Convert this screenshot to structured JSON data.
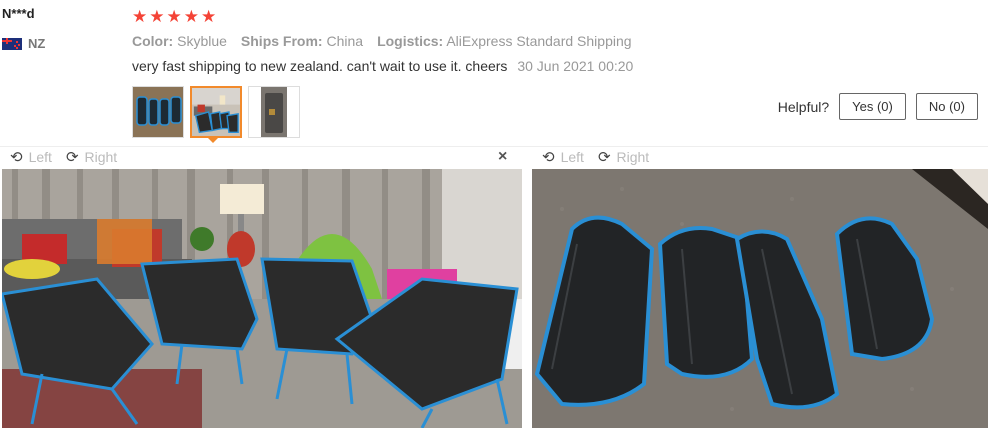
{
  "review": {
    "user": "N***d",
    "country": "NZ",
    "rating": 5,
    "star_glyph": "★",
    "color_label": "Color:",
    "color_value": "Skyblue",
    "ships_label": "Ships From:",
    "ships_value": "China",
    "logistics_label": "Logistics:",
    "logistics_value": "AliExpress Standard Shipping",
    "text": "very fast shipping to new zealand. can't wait to use it. cheers",
    "date": "30 Jun 2021 00:20"
  },
  "helpful": {
    "label": "Helpful?",
    "yes": "Yes (0)",
    "no": "No (0)"
  },
  "viewer": {
    "left_label": "Left",
    "right_label": "Right",
    "close_glyph": "×",
    "rotate_left_glyph": "⟲",
    "rotate_right_glyph": "⟳"
  },
  "colors": {
    "star": "#f44336",
    "active_thumb": "#f28a2b"
  }
}
